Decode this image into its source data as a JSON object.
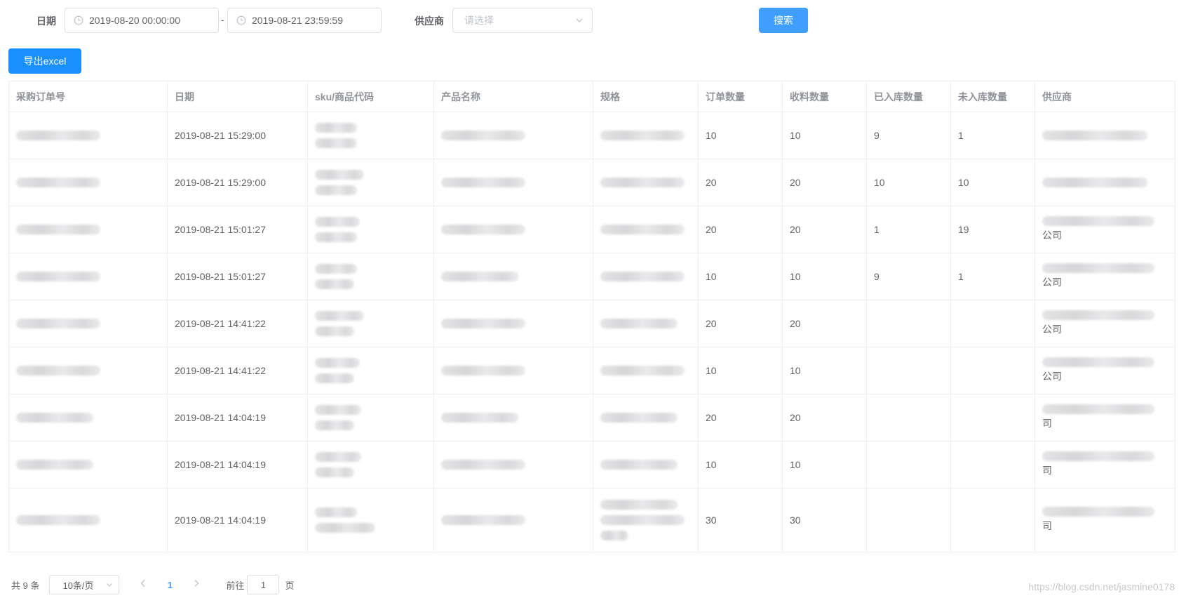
{
  "filters": {
    "date_label": "日期",
    "date_start": "2019-08-20 00:00:00",
    "date_sep": "-",
    "date_end": "2019-08-21 23:59:59",
    "supplier_label": "供应商",
    "supplier_placeholder": "请选择",
    "search_button": "搜索"
  },
  "toolbar": {
    "export_button": "导出excel"
  },
  "table": {
    "columns": [
      "采购订单号",
      "日期",
      "sku/商品代码",
      "产品名称",
      "规格",
      "订单数量",
      "收料数量",
      "已入库数量",
      "未入库数量",
      "供应商"
    ],
    "rows": [
      {
        "date": "2019-08-21 15:29:00",
        "order_qty": "10",
        "received_qty": "10",
        "stocked_qty": "9",
        "unstocked_qty": "1",
        "supplier_tail": ""
      },
      {
        "date": "2019-08-21 15:29:00",
        "order_qty": "20",
        "received_qty": "20",
        "stocked_qty": "10",
        "unstocked_qty": "10",
        "supplier_tail": ""
      },
      {
        "date": "2019-08-21 15:01:27",
        "order_qty": "20",
        "received_qty": "20",
        "stocked_qty": "1",
        "unstocked_qty": "19",
        "supplier_tail": "公司"
      },
      {
        "date": "2019-08-21 15:01:27",
        "order_qty": "10",
        "received_qty": "10",
        "stocked_qty": "9",
        "unstocked_qty": "1",
        "supplier_tail": "公司"
      },
      {
        "date": "2019-08-21 14:41:22",
        "order_qty": "20",
        "received_qty": "20",
        "stocked_qty": "",
        "unstocked_qty": "",
        "supplier_tail": "公司"
      },
      {
        "date": "2019-08-21 14:41:22",
        "order_qty": "10",
        "received_qty": "10",
        "stocked_qty": "",
        "unstocked_qty": "",
        "supplier_tail": "公司"
      },
      {
        "date": "2019-08-21 14:04:19",
        "order_qty": "20",
        "received_qty": "20",
        "stocked_qty": "",
        "unstocked_qty": "",
        "supplier_tail": "司"
      },
      {
        "date": "2019-08-21 14:04:19",
        "order_qty": "10",
        "received_qty": "10",
        "stocked_qty": "",
        "unstocked_qty": "",
        "supplier_tail": "司"
      },
      {
        "date": "2019-08-21 14:04:19",
        "order_qty": "30",
        "received_qty": "30",
        "stocked_qty": "",
        "unstocked_qty": "",
        "supplier_tail": "司"
      }
    ]
  },
  "pagination": {
    "total": "共 9 条",
    "page_size": "10条/页",
    "prev_icon": "chevron-left-icon",
    "current_page": "1",
    "next_icon": "chevron-right-icon",
    "goto_label": "前往",
    "goto_value": "1",
    "goto_suffix": "页"
  },
  "watermark": "https://blog.csdn.net/jasmine0178",
  "colors": {
    "primary": "#409eff",
    "export_button": "#1890ff",
    "border": "#ebeef5",
    "header_text": "#909399"
  }
}
